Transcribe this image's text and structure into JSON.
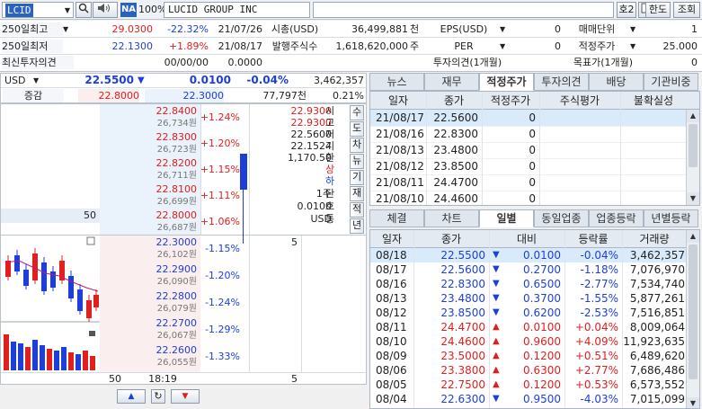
{
  "topbar": {
    "code": "LCID",
    "na_badge": "NA",
    "zoom": "100%",
    "name": "LUCID GROUP INC",
    "btn_ho2": "호2",
    "btn_limit": "한도",
    "btn_query": "조회"
  },
  "info": {
    "r1": {
      "label": "250일최고",
      "price": "29.0300",
      "rate": "-22.32%",
      "date": "21/07/26",
      "mid_label": "시총(USD)",
      "mid_value": "36,499,881",
      "mid_unit": "천",
      "eps_label": "EPS(USD)",
      "eps_value": "0",
      "right_label": "매매단위",
      "right_value": "1"
    },
    "r2": {
      "label": "250일최저",
      "price": "22.1300",
      "rate": "+1.89%",
      "date": "21/08/17",
      "mid_label": "발행주식수",
      "mid_value": "1,618,620,000",
      "mid_unit": "주",
      "eps_label": "PER",
      "eps_value": "0",
      "right_label": "적정주가",
      "right_value": "25.000"
    },
    "r3": {
      "label": "최신투자의견",
      "date": "00/00/00",
      "value": "0.0000",
      "opinion_label": "투자의견(1개월)",
      "target_label": "목표가(1개월)",
      "target_value": "0"
    }
  },
  "price": {
    "currency": "USD",
    "current": "22.5500",
    "arrow": "▼",
    "change": "0.0100",
    "rate": "-0.04%",
    "volume": "3,462,357",
    "sub_label": "증감",
    "high": "22.8000",
    "low": "22.3000",
    "sub_volume": "77,797천",
    "sub_rate": "0.21%"
  },
  "book": {
    "asks": [
      {
        "price": "22.8400",
        "qty": "26,734원",
        "rate": "+1.24%"
      },
      {
        "price": "22.8300",
        "qty": "26,723원",
        "rate": "+1.20%"
      },
      {
        "price": "22.8200",
        "qty": "26,711원",
        "rate": "+1.15%"
      },
      {
        "price": "22.8100",
        "qty": "26,699원",
        "rate": "+1.11%"
      },
      {
        "price": "22.8000",
        "qty": "26,687원",
        "rate": "+1.06%"
      }
    ],
    "bids": [
      {
        "price": "22.3000",
        "qty": "26,102원",
        "rate": "-1.15%"
      },
      {
        "price": "22.2900",
        "qty": "26,090원",
        "rate": "-1.20%"
      },
      {
        "price": "22.2800",
        "qty": "26,079원",
        "rate": "-1.24%"
      },
      {
        "price": "22.2700",
        "qty": "26,067원",
        "rate": "-1.29%"
      },
      {
        "price": "22.2600",
        "qty": "26,055원",
        "rate": "-1.33%"
      }
    ],
    "ask_qty_50": "50",
    "bid_qty_5": "5",
    "stats": [
      "22.9300",
      "22.9300",
      "22.5600",
      "22.1524",
      "1,170.50"
    ],
    "stat_labels": [
      "시",
      "고",
      "저",
      "기",
      "환"
    ],
    "stat_labels2": [
      "상",
      "하"
    ],
    "unit_row1": "1주",
    "unit_row2": "0.0100",
    "unit_row3": "USD",
    "unit_lbls": [
      "단",
      "호",
      "통"
    ],
    "side_buttons": [
      "수",
      "도",
      "차",
      "뉴",
      "기",
      "재",
      "적",
      "년"
    ],
    "bottom_qty": "50",
    "bottom_time": "18:19",
    "bottom_right": "5"
  },
  "tabs_top": [
    "뉴스",
    "재무",
    "적정주가",
    "투자의견",
    "배당",
    "기관비중"
  ],
  "fair": {
    "headers": [
      "일자",
      "종가",
      "적정주가",
      "주식평가",
      "불확실성"
    ],
    "rows": [
      [
        "21/08/17",
        "22.5600",
        "0"
      ],
      [
        "21/08/16",
        "22.8300",
        "0"
      ],
      [
        "21/08/13",
        "23.4800",
        "0"
      ],
      [
        "21/08/12",
        "23.8500",
        "0"
      ],
      [
        "21/08/11",
        "24.4700",
        "0"
      ],
      [
        "21/08/10",
        "24.4600",
        "0"
      ]
    ]
  },
  "tabs_bottom": [
    "체결",
    "차트",
    "일별",
    "동일업종",
    "업종등락",
    "년별등락"
  ],
  "daily": {
    "headers": [
      "일자",
      "종가",
      "대비",
      "등락률",
      "거래량"
    ],
    "rows": [
      {
        "date": "08/18",
        "close": "22.5500",
        "dir": "down",
        "diff": "0.0100",
        "rate": "-0.04%",
        "vol": "3,462,357"
      },
      {
        "date": "08/17",
        "close": "22.5600",
        "dir": "down",
        "diff": "0.2700",
        "rate": "-1.18%",
        "vol": "7,076,970"
      },
      {
        "date": "08/16",
        "close": "22.8300",
        "dir": "down",
        "diff": "0.6500",
        "rate": "-2.77%",
        "vol": "7,534,740"
      },
      {
        "date": "08/13",
        "close": "23.4800",
        "dir": "down",
        "diff": "0.3700",
        "rate": "-1.55%",
        "vol": "5,877,261"
      },
      {
        "date": "08/12",
        "close": "23.8500",
        "dir": "down",
        "diff": "0.6200",
        "rate": "-2.53%",
        "vol": "7,516,851"
      },
      {
        "date": "08/11",
        "close": "24.4700",
        "dir": "up",
        "diff": "0.0100",
        "rate": "+0.04%",
        "vol": "8,009,064"
      },
      {
        "date": "08/10",
        "close": "24.4600",
        "dir": "up",
        "diff": "0.9600",
        "rate": "+4.09%",
        "vol": "11,923,635"
      },
      {
        "date": "08/09",
        "close": "23.5000",
        "dir": "up",
        "diff": "0.1200",
        "rate": "+0.51%",
        "vol": "6,489,620"
      },
      {
        "date": "08/06",
        "close": "23.3800",
        "dir": "up",
        "diff": "0.6300",
        "rate": "+2.77%",
        "vol": "7,686,486"
      },
      {
        "date": "08/05",
        "close": "22.7500",
        "dir": "up",
        "diff": "0.1200",
        "rate": "+0.53%",
        "vol": "6,573,552"
      },
      {
        "date": "08/04",
        "close": "22.6300",
        "dir": "down",
        "diff": "0.9500",
        "rate": "-4.03%",
        "vol": "7,015,099"
      }
    ]
  },
  "colors": {
    "up": "#e0201f",
    "down": "#1d3fd8",
    "accent": "#2b62c0"
  }
}
